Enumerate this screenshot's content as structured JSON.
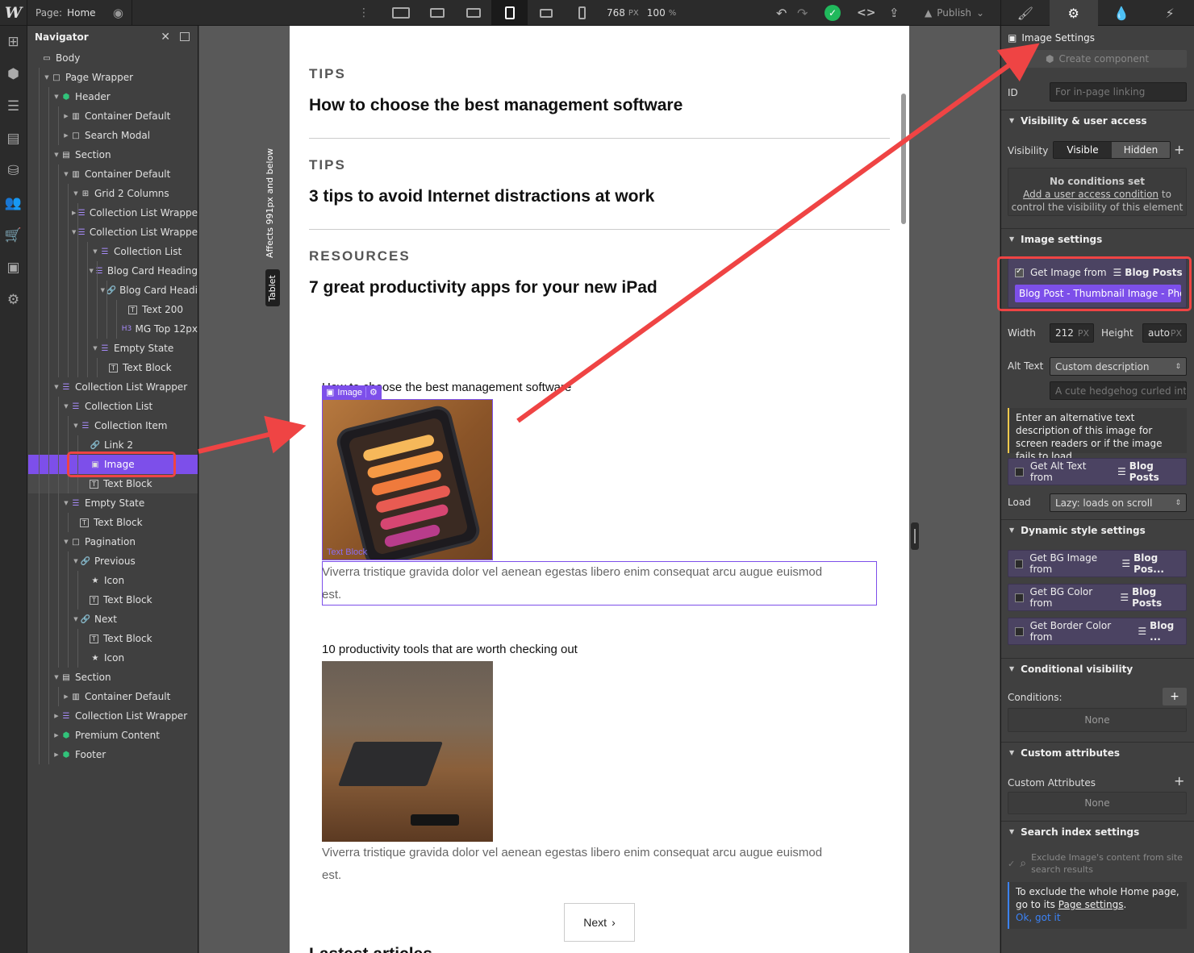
{
  "topbar": {
    "page_label": "Page:",
    "page_name": "Home",
    "width_value": "768",
    "width_unit": "PX",
    "zoom_value": "100",
    "zoom_unit": "%",
    "publish_label": "Publish"
  },
  "navigator": {
    "title": "Navigator",
    "items": [
      {
        "label": "Body",
        "depth": 0,
        "icon": "body-icon",
        "caret": ""
      },
      {
        "label": "Page Wrapper",
        "depth": 1,
        "icon": "div-block-icon",
        "caret": "open"
      },
      {
        "label": "Header",
        "depth": 2,
        "icon": "symbol-icon",
        "caret": "open"
      },
      {
        "label": "Container Default",
        "depth": 3,
        "icon": "container-icon",
        "caret": "closed"
      },
      {
        "label": "Search Modal",
        "depth": 3,
        "icon": "div-block-icon",
        "caret": "closed"
      },
      {
        "label": "Section",
        "depth": 2,
        "icon": "section-icon",
        "caret": "open"
      },
      {
        "label": "Container Default",
        "depth": 3,
        "icon": "container-icon",
        "caret": "open"
      },
      {
        "label": "Grid 2 Columns",
        "depth": 4,
        "icon": "grid-icon",
        "caret": "open"
      },
      {
        "label": "Collection List Wrappe",
        "depth": 5,
        "icon": "collection-icon",
        "caret": "closed"
      },
      {
        "label": "Collection List Wrappe",
        "depth": 5,
        "icon": "collection-icon",
        "caret": "open"
      },
      {
        "label": "Collection List",
        "depth": 6,
        "icon": "collection-list-icon",
        "caret": "open"
      },
      {
        "label": "Blog Card Heading",
        "depth": 7,
        "icon": "collection-item-icon",
        "caret": "open"
      },
      {
        "label": "Blog Card Headi",
        "depth": 8,
        "icon": "link-icon",
        "caret": "open"
      },
      {
        "label": "Text 200",
        "depth": 9,
        "icon": "text-icon",
        "caret": ""
      },
      {
        "label": "MG Top 12px",
        "depth": 9,
        "icon": "heading-icon",
        "caret": ""
      },
      {
        "label": "Empty State",
        "depth": 6,
        "icon": "collection-list-icon",
        "caret": "open"
      },
      {
        "label": "Text Block",
        "depth": 7,
        "icon": "text-icon",
        "caret": ""
      },
      {
        "label": "Collection List Wrapper",
        "depth": 2,
        "icon": "collection-icon",
        "caret": "open"
      },
      {
        "label": "Collection List",
        "depth": 3,
        "icon": "collection-list-icon",
        "caret": "open"
      },
      {
        "label": "Collection Item",
        "depth": 4,
        "icon": "collection-item-icon",
        "caret": "open"
      },
      {
        "label": "Link 2",
        "depth": 5,
        "icon": "link-icon",
        "caret": ""
      },
      {
        "label": "Image",
        "depth": 5,
        "icon": "image-icon",
        "caret": "",
        "selected": true
      },
      {
        "label": "Text Block",
        "depth": 5,
        "icon": "text-icon",
        "caret": "",
        "sub": true
      },
      {
        "label": "Empty State",
        "depth": 3,
        "icon": "collection-list-icon",
        "caret": "open"
      },
      {
        "label": "Text Block",
        "depth": 4,
        "icon": "text-icon",
        "caret": ""
      },
      {
        "label": "Pagination",
        "depth": 3,
        "icon": "div-block-icon",
        "caret": "open"
      },
      {
        "label": "Previous",
        "depth": 4,
        "icon": "link-icon",
        "caret": "open"
      },
      {
        "label": "Icon",
        "depth": 5,
        "icon": "star-icon",
        "caret": ""
      },
      {
        "label": "Text Block",
        "depth": 5,
        "icon": "text-icon",
        "caret": ""
      },
      {
        "label": "Next",
        "depth": 4,
        "icon": "link-icon",
        "caret": "open"
      },
      {
        "label": "Text Block",
        "depth": 5,
        "icon": "text-icon",
        "caret": ""
      },
      {
        "label": "Icon",
        "depth": 5,
        "icon": "star-icon",
        "caret": ""
      },
      {
        "label": "Section",
        "depth": 2,
        "icon": "section-icon",
        "caret": "open"
      },
      {
        "label": "Container Default",
        "depth": 3,
        "icon": "container-icon",
        "caret": "closed"
      },
      {
        "label": "Collection List Wrapper",
        "depth": 2,
        "icon": "collection-icon",
        "caret": "closed"
      },
      {
        "label": "Premium Content",
        "depth": 2,
        "icon": "symbol-icon",
        "caret": "closed"
      },
      {
        "label": "Footer",
        "depth": 2,
        "icon": "symbol-icon",
        "caret": "closed"
      }
    ]
  },
  "canvas": {
    "breakpoint_note": "Affects 991px and below",
    "breakpoint_label": "Tablet",
    "articles": [
      {
        "category": "TIPS",
        "title": "How to choose the best management software"
      },
      {
        "category": "TIPS",
        "title": "3 tips to avoid Internet distractions at work"
      },
      {
        "category": "RESOURCES",
        "title": "7 great productivity apps for your new iPad"
      }
    ],
    "cards": [
      {
        "title": "How to choose the best management software",
        "desc_line1": "Viverra tristique gravida dolor vel aenean egestas libero enim consequat arcu augue euismod",
        "desc_line2": "est."
      },
      {
        "title": "10 productivity tools that are worth checking out",
        "desc_line1": "Viverra tristique gravida dolor vel aenean egestas libero enim consequat arcu augue euismod",
        "desc_line2": "est."
      }
    ],
    "image_tag": "Image",
    "text_block_ghost": "Text Block",
    "next_button": "Next",
    "next_chevron": "›",
    "latest_heading": "Lastest articles"
  },
  "settings": {
    "panel_title": "Image Settings",
    "create_component": "Create component",
    "id_label": "ID",
    "id_placeholder": "For in-page linking",
    "visibility_section": "Visibility & user access",
    "visibility_label": "Visibility",
    "visible": "Visible",
    "hidden": "Hidden",
    "no_conditions_title": "No conditions set",
    "no_conditions_link": "Add a user access condition",
    "no_conditions_to": "to",
    "no_conditions_rest": "control the visibility of this element",
    "image_section": "Image settings",
    "get_image_from": "Get Image from",
    "blog_posts": "Blog Posts",
    "field_binding": "Blog Post - Thumbnail Image - Phot",
    "width_label": "Width",
    "width_value": "212",
    "width_unit": "PX",
    "height_label": "Height",
    "height_value": "auto",
    "height_unit": "PX",
    "alt_label": "Alt Text",
    "alt_option": "Custom description",
    "alt_placeholder": "A cute hedgehog curled into",
    "alt_help": "Enter an alternative text description of this image for screen readers or if the image fails to load.",
    "get_alt_from": "Get Alt Text from",
    "load_label": "Load",
    "load_option": "Lazy: loads on scroll",
    "dynamic_section": "Dynamic style settings",
    "bg_image": "Get BG Image from",
    "bg_image_src": "Blog Pos...",
    "bg_color": "Get BG Color from",
    "bg_color_src": "Blog Posts",
    "border_color": "Get Border Color from",
    "border_color_src": "Blog ...",
    "conditional_section": "Conditional visibility",
    "conditions_label": "Conditions:",
    "none": "None",
    "custom_attr_section": "Custom attributes",
    "custom_attr_label": "Custom Attributes",
    "search_section": "Search index settings",
    "exclude_text": "Exclude Image's content from site search results",
    "exclude_page_1": "To exclude the whole Home page, go to its",
    "exclude_page_link": "Page settings",
    "ok_got_it": "Ok, got it"
  },
  "colors": {
    "accent": "#7d4fea",
    "annotation": "#ef4444",
    "success": "#20b95c"
  }
}
